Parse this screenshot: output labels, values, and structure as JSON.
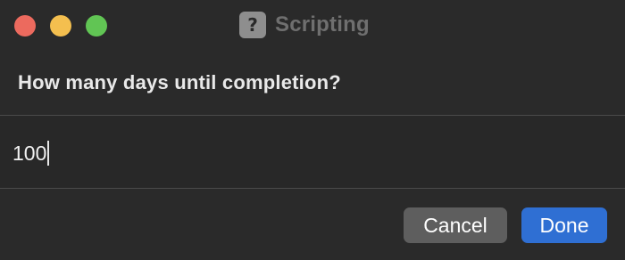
{
  "window": {
    "title": "Scripting",
    "app_icon": {
      "glyph": "?",
      "name": "question-mark-icon"
    },
    "traffic_lights": {
      "close_color": "#ec6a5e",
      "minimize_color": "#f4bf4f",
      "zoom_color": "#61c554"
    }
  },
  "dialog": {
    "prompt": "How many days until completion?",
    "answer_value": "100",
    "buttons": {
      "cancel_label": "Cancel",
      "done_label": "Done"
    },
    "accent_color": "#2f6fd3"
  }
}
